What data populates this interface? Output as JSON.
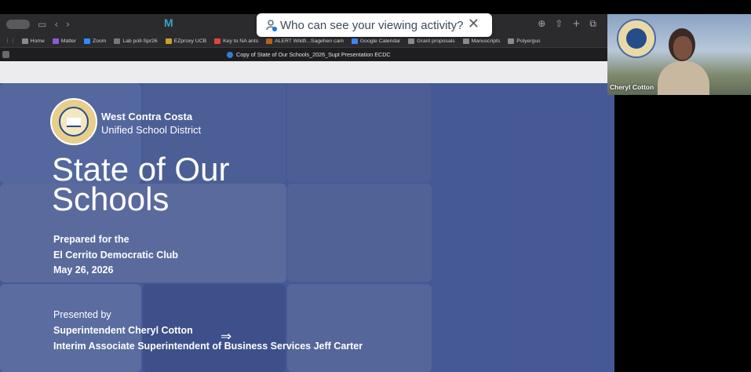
{
  "popup": {
    "text": "Who can see your viewing activity?"
  },
  "toolbar": {
    "ext_label": "M"
  },
  "bookmarks": [
    {
      "label": "Home",
      "color": "#8a8a90"
    },
    {
      "label": "Matter",
      "color": "#8b5bd6"
    },
    {
      "label": "Zoom",
      "color": "#2d8cff"
    },
    {
      "label": "Lab poll-Spr26",
      "color": "#777"
    },
    {
      "label": "EZproxy UCB",
      "color": "#c9a227"
    },
    {
      "label": "Key to NA ants",
      "color": "#d94a3a"
    },
    {
      "label": "ALERT Wildfi...Sagehen cam",
      "color": "#b5651d"
    },
    {
      "label": "Google Calendar",
      "color": "#4285f4"
    },
    {
      "label": "Grant proposals",
      "color": "#8a8a90"
    },
    {
      "label": "Manuscripts",
      "color": "#8a8a90"
    },
    {
      "label": "Polyergus",
      "color": "#8a8a90"
    }
  ],
  "tab": {
    "title": "Copy of State of Our Schools_2026_Supt Presentation ECDC"
  },
  "slide": {
    "district_line1": "West Contra Costa",
    "district_line2": "Unified School District",
    "title_line1": "State of Our",
    "title_line2": "Schools",
    "prepared_line1": "Prepared for the",
    "prepared_line2": "El Cerrito Democratic Club",
    "prepared_line3": "May 26, 2026",
    "presented_by": "Presented by",
    "presenter1": "Superintendent Cheryl Cotton",
    "presenter2": "Interim Associate Superintendent of Business Services Jeff Carter"
  },
  "video": {
    "name": "Cheryl Cotton"
  }
}
